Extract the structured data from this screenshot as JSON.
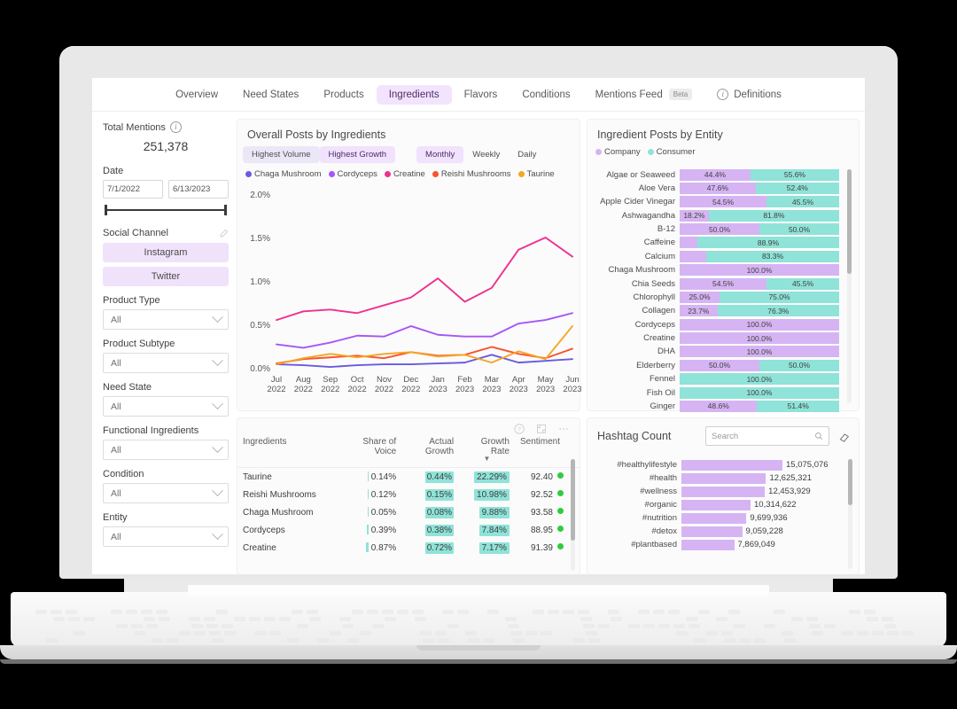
{
  "nav": {
    "items": [
      {
        "label": "Overview",
        "active": false
      },
      {
        "label": "Need States",
        "active": false
      },
      {
        "label": "Products",
        "active": false
      },
      {
        "label": "Ingredients",
        "active": true
      },
      {
        "label": "Flavors",
        "active": false
      },
      {
        "label": "Conditions",
        "active": false
      }
    ],
    "mentions_feed": "Mentions Feed",
    "beta_badge": "Beta",
    "definitions": "Definitions"
  },
  "sidebar": {
    "total_mentions_label": "Total Mentions",
    "total_mentions_value": "251,378",
    "date_label": "Date",
    "date_start": "7/1/2022",
    "date_end": "6/13/2023",
    "social_channel_label": "Social Channel",
    "channels": [
      "Instagram",
      "Twitter"
    ],
    "filters": [
      {
        "label": "Product Type",
        "value": "All"
      },
      {
        "label": "Product Subtype",
        "value": "All"
      },
      {
        "label": "Need State",
        "value": "All"
      },
      {
        "label": "Functional Ingredients",
        "value": "All"
      },
      {
        "label": "Condition",
        "value": "All"
      },
      {
        "label": "Entity",
        "value": "All"
      }
    ]
  },
  "line_panel": {
    "title": "Overall Posts by Ingredients",
    "rank_tabs": [
      {
        "label": "Highest Volume",
        "active": false
      },
      {
        "label": "Highest Growth",
        "active": true
      }
    ],
    "period_tabs": [
      {
        "label": "Monthly",
        "active": true
      },
      {
        "label": "Weekly",
        "active": false
      },
      {
        "label": "Daily",
        "active": false
      }
    ]
  },
  "entity_panel": {
    "title": "Ingredient Posts by Entity",
    "legend": [
      {
        "label": "Company",
        "color": "#d6b4f3"
      },
      {
        "label": "Consumer",
        "color": "#8fe3d8"
      }
    ]
  },
  "table_panel": {
    "columns": [
      "Ingredients",
      "Share of Voice",
      "Actual Growth",
      "Growth Rate",
      "Sentiment"
    ],
    "sort_column": "Growth Rate"
  },
  "hashtag_panel": {
    "title": "Hashtag Count",
    "search_placeholder": "Search"
  },
  "chart_data": [
    {
      "type": "line",
      "title": "Overall Posts by Ingredients",
      "xlabel": "",
      "ylabel": "",
      "ylim": [
        0,
        2.0
      ],
      "yticks": [
        "0.0%",
        "0.5%",
        "1.0%",
        "1.5%",
        "2.0%"
      ],
      "x": [
        "Jul 2022",
        "Aug 2022",
        "Sep 2022",
        "Oct 2022",
        "Nov 2022",
        "Dec 2022",
        "Jan 2023",
        "Feb 2023",
        "Mar 2023",
        "Apr 2023",
        "May 2023",
        "Jun 2023"
      ],
      "series": [
        {
          "name": "Chaga Mushroom",
          "color": "#6a5ae0",
          "values": [
            0.04,
            0.03,
            0.01,
            0.03,
            0.04,
            0.04,
            0.05,
            0.06,
            0.15,
            0.06,
            0.08,
            0.1
          ]
        },
        {
          "name": "Cordyceps",
          "color": "#a855f7",
          "values": [
            0.27,
            0.23,
            0.29,
            0.37,
            0.36,
            0.48,
            0.38,
            0.36,
            0.36,
            0.51,
            0.55,
            0.63
          ]
        },
        {
          "name": "Creatine",
          "color": "#f0308f",
          "values": [
            0.55,
            0.65,
            0.67,
            0.63,
            0.72,
            0.81,
            1.03,
            0.76,
            0.92,
            1.36,
            1.5,
            1.28
          ]
        },
        {
          "name": "Reishi Mushrooms",
          "color": "#f9522f",
          "values": [
            0.05,
            0.1,
            0.12,
            0.14,
            0.11,
            0.18,
            0.14,
            0.15,
            0.24,
            0.16,
            0.11,
            0.22
          ]
        },
        {
          "name": "Taurine",
          "color": "#f5a623",
          "values": [
            0.04,
            0.11,
            0.16,
            0.12,
            0.16,
            0.18,
            0.13,
            0.15,
            0.06,
            0.19,
            0.1,
            0.48
          ]
        }
      ]
    },
    {
      "type": "bar",
      "orientation": "horizontal",
      "stacked": true,
      "title": "Ingredient Posts by Entity",
      "categories": [
        "Algae or Seaweed",
        "Aloe Vera",
        "Apple Cider Vinegar",
        "Ashwagandha",
        "B-12",
        "Caffeine",
        "Calcium",
        "Chaga Mushroom",
        "Chia Seeds",
        "Chlorophyll",
        "Collagen",
        "Cordyceps",
        "Creatine",
        "DHA",
        "Elderberry",
        "Fennel",
        "Fish Oil",
        "Ginger"
      ],
      "series": [
        {
          "name": "Company",
          "color": "#d6b4f3",
          "values": [
            44.4,
            47.6,
            54.5,
            18.2,
            50.0,
            11.1,
            16.7,
            100.0,
            54.5,
            25.0,
            23.7,
            100.0,
            100.0,
            100.0,
            50.0,
            0.0,
            0.0,
            48.6
          ]
        },
        {
          "name": "Consumer",
          "color": "#8fe3d8",
          "values": [
            55.6,
            52.4,
            45.5,
            81.8,
            50.0,
            88.9,
            83.3,
            0.0,
            45.5,
            75.0,
            76.3,
            0.0,
            0.0,
            0.0,
            50.0,
            100.0,
            100.0,
            51.4
          ]
        }
      ],
      "labels": [
        [
          "44.4%",
          "55.6%"
        ],
        [
          "47.6%",
          "52.4%"
        ],
        [
          "54.5%",
          "45.5%"
        ],
        [
          "18.2%",
          "81.8%"
        ],
        [
          "50.0%",
          "50.0%"
        ],
        [
          "",
          "88.9%"
        ],
        [
          "",
          "83.3%"
        ],
        [
          "100.0%",
          ""
        ],
        [
          "54.5%",
          "45.5%"
        ],
        [
          "25.0%",
          "75.0%"
        ],
        [
          "23.7%",
          "76.3%"
        ],
        [
          "100.0%",
          ""
        ],
        [
          "100.0%",
          ""
        ],
        [
          "100.0%",
          ""
        ],
        [
          "50.0%",
          "50.0%"
        ],
        [
          "",
          "100.0%"
        ],
        [
          "",
          "100.0%"
        ],
        [
          "48.6%",
          "51.4%"
        ]
      ]
    },
    {
      "type": "table",
      "title": "Ingredients growth table",
      "columns": [
        "Ingredients",
        "Share of Voice",
        "Actual Growth",
        "Growth Rate",
        "Sentiment"
      ],
      "rows": [
        {
          "ingredient": "Taurine",
          "share_of_voice": "0.14%",
          "actual_growth": "0.44%",
          "growth_rate": "22.29%",
          "sentiment": "92.40",
          "sov_bar": 16,
          "ag_bar": 30,
          "gr_bar": 100
        },
        {
          "ingredient": "Reishi Mushrooms",
          "share_of_voice": "0.12%",
          "actual_growth": "0.15%",
          "growth_rate": "10.98%",
          "sentiment": "92.52",
          "sov_bar": 14,
          "ag_bar": 12,
          "gr_bar": 62
        },
        {
          "ingredient": "Chaga Mushroom",
          "share_of_voice": "0.05%",
          "actual_growth": "0.08%",
          "growth_rate": "9.88%",
          "sentiment": "93.58",
          "sov_bar": 8,
          "ag_bar": 8,
          "gr_bar": 52
        },
        {
          "ingredient": "Cordyceps",
          "share_of_voice": "0.39%",
          "actual_growth": "0.38%",
          "growth_rate": "7.84%",
          "sentiment": "88.95",
          "sov_bar": 22,
          "ag_bar": 22,
          "gr_bar": 44
        },
        {
          "ingredient": "Creatine",
          "share_of_voice": "0.87%",
          "actual_growth": "0.72%",
          "growth_rate": "7.17%",
          "sentiment": "91.39",
          "sov_bar": 40,
          "ag_bar": 38,
          "gr_bar": 40
        }
      ]
    },
    {
      "type": "bar",
      "orientation": "horizontal",
      "title": "Hashtag Count",
      "categories": [
        "#healthylifestyle",
        "#health",
        "#wellness",
        "#organic",
        "#nutrition",
        "#detox",
        "#plantbased"
      ],
      "values": [
        15075076,
        12625321,
        12453929,
        10314622,
        9699936,
        9059228,
        7869049
      ],
      "value_labels": [
        "15,075,076",
        "12,625,321",
        "12,453,929",
        "10,314,622",
        "9,699,936",
        "9,059,228",
        "7,869,049"
      ],
      "color": "#d6b4f3"
    }
  ]
}
